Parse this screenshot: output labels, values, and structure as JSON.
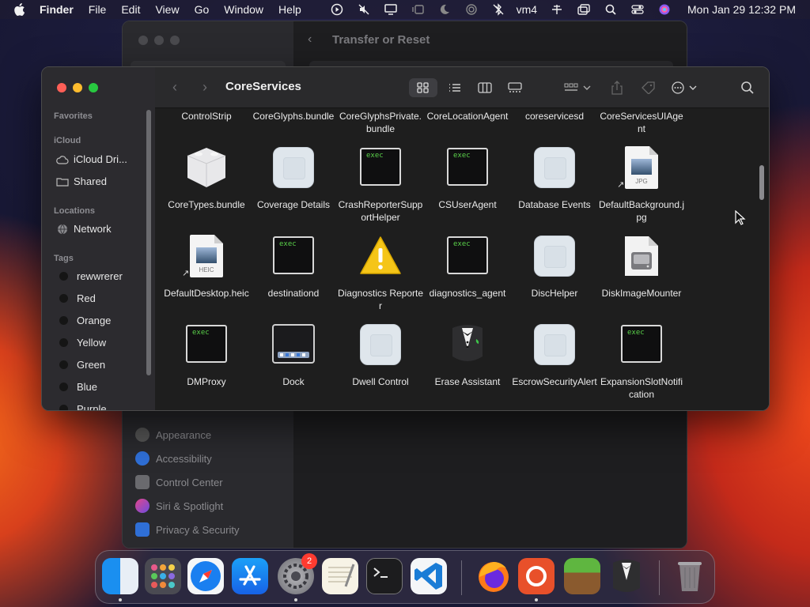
{
  "menubar": {
    "app": "Finder",
    "items": [
      "File",
      "Edit",
      "View",
      "Go",
      "Window",
      "Help"
    ],
    "vm": "vm4",
    "clock": "Mon Jan 29  12:32 PM"
  },
  "settings": {
    "title": "Transfer or Reset",
    "items": [
      "Appearance",
      "Accessibility",
      "Control Center",
      "Siri & Spotlight",
      "Privacy & Security"
    ]
  },
  "finder": {
    "title": "CoreServices",
    "sidebar": {
      "favorites_label": "Favorites",
      "icloud_label": "iCloud",
      "icloud_items": [
        "iCloud Dri...",
        "Shared"
      ],
      "locations_label": "Locations",
      "locations_items": [
        "Network"
      ],
      "tags_label": "Tags",
      "tags": [
        {
          "name": "rewwrerer",
          "color": "#1c1c1c"
        },
        {
          "name": "Red",
          "color": "#1c1c1c"
        },
        {
          "name": "Orange",
          "color": "#1c1c1c"
        },
        {
          "name": "Yellow",
          "color": "#1c1c1c"
        },
        {
          "name": "Green",
          "color": "#1c1c1c"
        },
        {
          "name": "Blue",
          "color": "#1c1c1c"
        },
        {
          "name": "Purple",
          "color": "#1c1c1c"
        }
      ]
    },
    "top_row": [
      "ControlStrip",
      "CoreGlyphs.bundle",
      "CoreGlyphsPrivate.bundle",
      "CoreLocationAgent",
      "coreservicesd",
      "CoreServicesUIAgent"
    ],
    "rows": [
      [
        {
          "name": "CoreTypes.bundle",
          "kind": "lego"
        },
        {
          "name": "Coverage Details",
          "kind": "blank"
        },
        {
          "name": "CrashReporterSupportHelper",
          "kind": "exec"
        },
        {
          "name": "CSUserAgent",
          "kind": "exec"
        },
        {
          "name": "Database Events",
          "kind": "blank"
        },
        {
          "name": "DefaultBackground.jpg",
          "kind": "doc",
          "ext": "JPG"
        }
      ],
      [
        {
          "name": "DefaultDesktop.heic",
          "kind": "doc",
          "ext": "HEIC"
        },
        {
          "name": "destinationd",
          "kind": "exec"
        },
        {
          "name": "Diagnostics Reporter",
          "kind": "warning"
        },
        {
          "name": "diagnostics_agent",
          "kind": "exec"
        },
        {
          "name": "DiscHelper",
          "kind": "blank"
        },
        {
          "name": "DiskImageMounter",
          "kind": "disk"
        }
      ],
      [
        {
          "name": "DMProxy",
          "kind": "exec"
        },
        {
          "name": "Dock",
          "kind": "dock"
        },
        {
          "name": "Dwell Control",
          "kind": "blank"
        },
        {
          "name": "Erase Assistant",
          "kind": "tux"
        },
        {
          "name": "EscrowSecurityAlert",
          "kind": "blank"
        },
        {
          "name": "ExpansionSlotNotification",
          "kind": "exec"
        }
      ]
    ],
    "exec_label": "exec"
  },
  "dock": {
    "settings_badge": "2"
  }
}
